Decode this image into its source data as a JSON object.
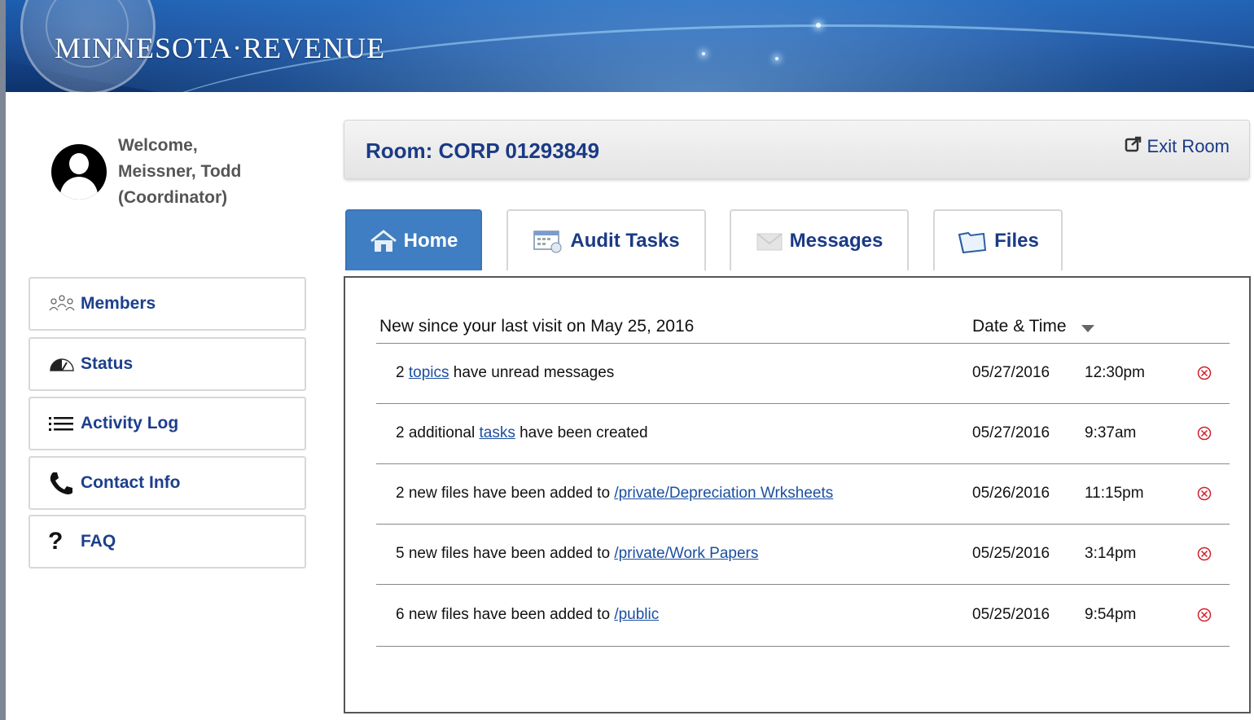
{
  "banner": {
    "brand": "MINNESOTA·REVENUE"
  },
  "user": {
    "line1": "Welcome,",
    "line2": "Meissner, Todd",
    "line3": "(Coordinator)"
  },
  "sidebar": {
    "items": [
      {
        "label": "Members",
        "icon": "members-icon"
      },
      {
        "label": "Status",
        "icon": "gauge-icon"
      },
      {
        "label": "Activity Log",
        "icon": "list-icon"
      },
      {
        "label": "Contact Info",
        "icon": "phone-icon"
      },
      {
        "label": "FAQ",
        "icon": "question-icon"
      }
    ]
  },
  "room": {
    "title": "Room: CORP 01293849",
    "exit_label": "Exit Room"
  },
  "tabs": [
    {
      "label": "Home",
      "active": true,
      "icon": "home-icon"
    },
    {
      "label": "Audit Tasks",
      "active": false,
      "icon": "calendar-icon"
    },
    {
      "label": "Messages",
      "active": false,
      "icon": "envelope-icon"
    },
    {
      "label": "Files",
      "active": false,
      "icon": "folder-icon"
    }
  ],
  "activity": {
    "header_left": "New since your last visit on May 25, 2016",
    "header_right": "Date & Time",
    "rows": [
      {
        "prefix": "2 ",
        "link": "topics",
        "suffix": " have unread messages",
        "date": "05/27/2016",
        "time": "12:30pm"
      },
      {
        "prefix": "2 additional ",
        "link": "tasks",
        "suffix": " have been created",
        "date": "05/27/2016",
        "time": "9:37am"
      },
      {
        "prefix": "2 new files have been added to ",
        "link": "/private/Depreciation Wrksheets",
        "suffix": "",
        "date": "05/26/2016",
        "time": "11:15pm"
      },
      {
        "prefix": "5 new files have been added to ",
        "link": "/private/Work Papers",
        "suffix": "",
        "date": "05/25/2016",
        "time": "3:14pm"
      },
      {
        "prefix": "6 new files have been added to ",
        "link": "/public",
        "suffix": "",
        "date": "05/25/2016",
        "time": "9:54pm"
      }
    ]
  },
  "colors": {
    "brand_blue": "#1a3a85",
    "active_tab": "#3f7ec2",
    "link": "#1b4fa0",
    "delete_red": "#d0202a"
  }
}
